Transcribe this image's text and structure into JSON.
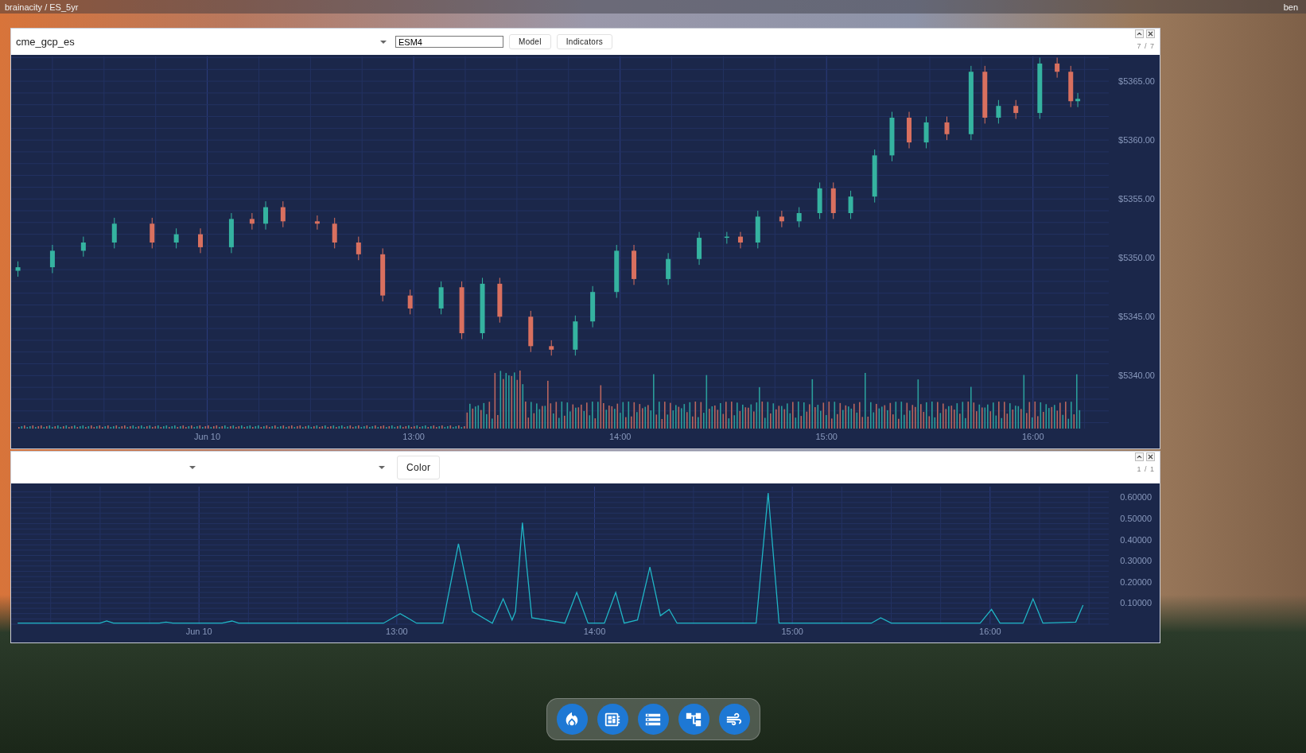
{
  "top_bar": {
    "path": "brainacity / ES_5yr",
    "user": "ben"
  },
  "panels": [
    {
      "kind": "price",
      "source": "cme_gcp_es",
      "symbol": "ESM4",
      "buttons": [
        "Model",
        "Indicators"
      ],
      "counter": "7 / 7",
      "chart_data": {
        "type": "candlestick",
        "x": [
          11.083,
          11.25,
          11.4,
          11.55,
          11.733,
          11.85,
          11.967,
          12.117,
          12.217,
          12.283,
          12.367,
          12.533,
          12.617,
          12.733,
          12.85,
          12.983,
          13.133,
          13.233,
          13.333,
          13.417,
          13.567,
          13.667,
          13.783,
          13.867,
          13.983,
          14.067,
          14.233,
          14.383,
          14.517,
          14.583,
          14.667,
          14.783,
          14.867,
          14.967,
          15.033,
          15.117,
          15.233,
          15.317,
          15.4,
          15.483,
          15.583,
          15.7,
          15.767,
          15.833,
          15.917,
          16.033,
          16.117,
          16.183,
          16.217
        ],
        "ohlc": [
          [
            5348.9,
            5349.7,
            5348.4,
            5349.2
          ],
          [
            5349.2,
            5351.1,
            5348.7,
            5350.6
          ],
          [
            5350.6,
            5351.8,
            5350.1,
            5351.3
          ],
          [
            5351.3,
            5353.4,
            5350.8,
            5352.9
          ],
          [
            5352.9,
            5353.4,
            5350.8,
            5351.3
          ],
          [
            5351.3,
            5352.5,
            5350.8,
            5352.0
          ],
          [
            5352.0,
            5352.5,
            5350.4,
            5350.9
          ],
          [
            5350.9,
            5353.8,
            5350.4,
            5353.3
          ],
          [
            5353.3,
            5353.8,
            5352.4,
            5352.9
          ],
          [
            5352.9,
            5354.8,
            5352.4,
            5354.3
          ],
          [
            5354.3,
            5354.8,
            5352.6,
            5353.1
          ],
          [
            5353.1,
            5353.6,
            5352.4,
            5352.9
          ],
          [
            5352.9,
            5353.4,
            5350.8,
            5351.3
          ],
          [
            5351.3,
            5351.8,
            5349.8,
            5350.3
          ],
          [
            5350.3,
            5350.8,
            5346.3,
            5346.8
          ],
          [
            5346.8,
            5347.3,
            5345.2,
            5345.7
          ],
          [
            5345.7,
            5348.0,
            5345.2,
            5347.5
          ],
          [
            5347.5,
            5348.0,
            5343.1,
            5343.6
          ],
          [
            5343.6,
            5348.3,
            5343.1,
            5347.8
          ],
          [
            5347.8,
            5348.3,
            5344.5,
            5345.0
          ],
          [
            5345.0,
            5345.5,
            5342.0,
            5342.5
          ],
          [
            5342.5,
            5343.0,
            5341.7,
            5342.2
          ],
          [
            5342.2,
            5345.1,
            5341.7,
            5344.6
          ],
          [
            5344.6,
            5347.6,
            5344.1,
            5347.1
          ],
          [
            5347.1,
            5351.1,
            5346.6,
            5350.6
          ],
          [
            5350.6,
            5351.1,
            5347.7,
            5348.2
          ],
          [
            5348.2,
            5350.4,
            5347.7,
            5349.9
          ],
          [
            5349.9,
            5352.2,
            5349.4,
            5351.7
          ],
          [
            5351.7,
            5352.2,
            5351.2,
            5351.8
          ],
          [
            5351.8,
            5352.2,
            5350.8,
            5351.3
          ],
          [
            5351.3,
            5354.0,
            5350.8,
            5353.5
          ],
          [
            5353.5,
            5354.0,
            5352.6,
            5353.1
          ],
          [
            5353.1,
            5354.3,
            5352.6,
            5353.8
          ],
          [
            5353.8,
            5356.4,
            5353.3,
            5355.9
          ],
          [
            5355.9,
            5356.4,
            5353.3,
            5353.8
          ],
          [
            5353.8,
            5355.7,
            5353.3,
            5355.2
          ],
          [
            5355.2,
            5359.2,
            5354.7,
            5358.7
          ],
          [
            5358.7,
            5362.4,
            5358.2,
            5361.9
          ],
          [
            5361.9,
            5362.4,
            5359.3,
            5359.8
          ],
          [
            5359.8,
            5362.0,
            5359.3,
            5361.5
          ],
          [
            5361.5,
            5362.0,
            5360.0,
            5360.5
          ],
          [
            5360.5,
            5366.3,
            5360.0,
            5365.8
          ],
          [
            5365.8,
            5366.3,
            5361.4,
            5361.9
          ],
          [
            5361.9,
            5363.4,
            5361.4,
            5362.9
          ],
          [
            5362.9,
            5363.4,
            5361.8,
            5362.3
          ],
          [
            5362.3,
            5367.0,
            5361.8,
            5366.5
          ],
          [
            5366.5,
            5367.0,
            5365.3,
            5365.8
          ],
          [
            5365.8,
            5366.3,
            5362.8,
            5363.3
          ],
          [
            5363.3,
            5364.0,
            5362.8,
            5363.5
          ]
        ],
        "xlim": [
          11.05,
          16.367
        ],
        "ylim": [
          5335.5,
          5367.1
        ],
        "grid": true,
        "xticks": [
          {
            "value": 12,
            "label": "Jun 10"
          },
          {
            "value": 13,
            "label": "13:00"
          },
          {
            "value": 14,
            "label": "14:00"
          },
          {
            "value": 15,
            "label": "15:00"
          },
          {
            "value": 16,
            "label": "16:00"
          }
        ],
        "yticks": [
          {
            "value": 5340,
            "label": "$5340.00"
          },
          {
            "value": 5345,
            "label": "$5345.00"
          },
          {
            "value": 5350,
            "label": "$5350.00"
          },
          {
            "value": 5355,
            "label": "$5355.00"
          },
          {
            "value": 5360,
            "label": "$5360.00"
          },
          {
            "value": 5365,
            "label": "$5365.00"
          }
        ]
      }
    },
    {
      "kind": "indicator",
      "buttons": [
        "Color"
      ],
      "counter": "1 / 1",
      "chart_data": {
        "type": "line",
        "x": [
          11.083,
          11.5,
          11.533,
          11.567,
          11.8,
          11.833,
          11.867,
          12.117,
          12.167,
          12.2,
          12.933,
          13.017,
          13.1,
          13.233,
          13.312,
          13.383,
          13.483,
          13.538,
          13.583,
          13.6,
          13.635,
          13.683,
          13.85,
          13.91,
          13.967,
          14.05,
          14.107,
          14.15,
          14.217,
          14.28,
          14.333,
          14.377,
          14.417,
          14.817,
          14.878,
          14.933,
          15.4,
          15.447,
          15.5,
          15.95,
          16.007,
          16.05,
          16.167,
          16.217,
          16.267,
          16.433,
          16.47
        ],
        "values": [
          0.005,
          0.005,
          0.015,
          0.005,
          0.005,
          0.01,
          0.005,
          0.005,
          0.015,
          0.005,
          0.005,
          0.05,
          0.005,
          0.005,
          0.38,
          0.06,
          0.005,
          0.12,
          0.02,
          0.06,
          0.48,
          0.03,
          0.005,
          0.15,
          0.005,
          0.005,
          0.15,
          0.005,
          0.02,
          0.27,
          0.04,
          0.07,
          0.005,
          0.005,
          0.62,
          0.005,
          0.005,
          0.03,
          0.005,
          0.005,
          0.07,
          0.005,
          0.005,
          0.12,
          0.005,
          0.01,
          0.09
        ],
        "xlim": [
          11.05,
          16.6
        ],
        "ylim": [
          0,
          0.65
        ],
        "grid": true,
        "xticks": [
          {
            "value": 12,
            "label": "Jun 10"
          },
          {
            "value": 13,
            "label": "13:00"
          },
          {
            "value": 14,
            "label": "14:00"
          },
          {
            "value": 15,
            "label": "15:00"
          },
          {
            "value": 16,
            "label": "16:00"
          }
        ],
        "yticks": [
          {
            "value": 0.1,
            "label": "0.10000"
          },
          {
            "value": 0.2,
            "label": "0.20000"
          },
          {
            "value": 0.3,
            "label": "0.30000"
          },
          {
            "value": 0.4,
            "label": "0.40000"
          },
          {
            "value": 0.5,
            "label": "0.50000"
          },
          {
            "value": 0.6,
            "label": "0.60000"
          }
        ]
      }
    }
  ]
}
